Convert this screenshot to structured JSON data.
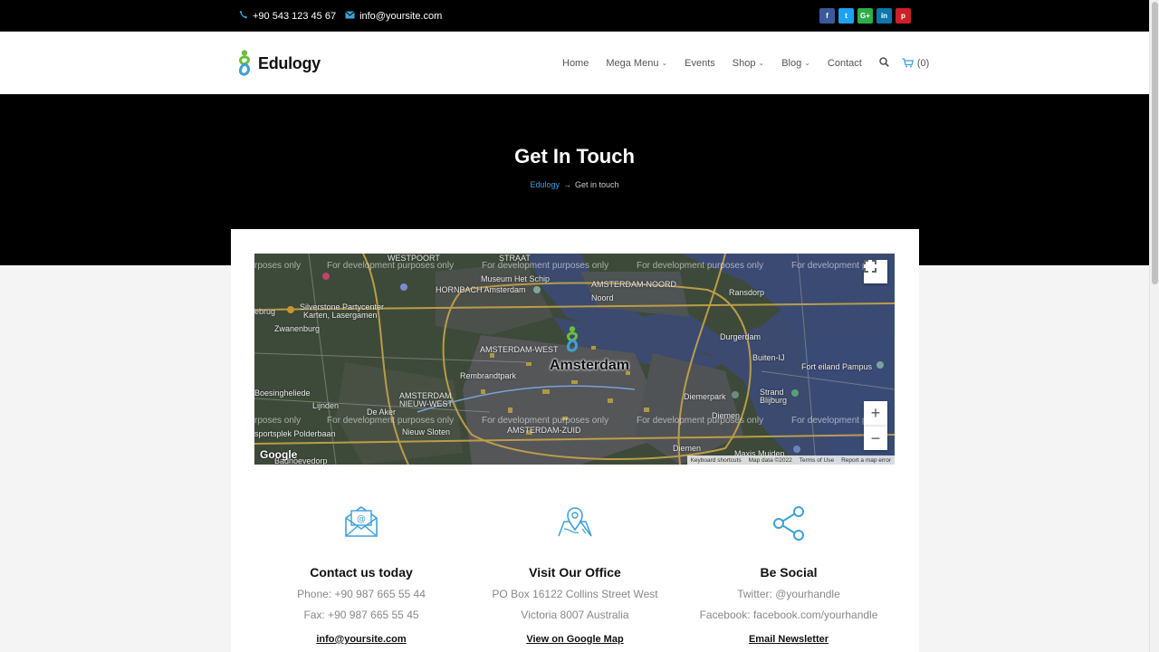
{
  "topbar": {
    "phone": "+90 543 123 45 67",
    "email": "info@yoursite.com",
    "socials": [
      {
        "name": "facebook",
        "glyph": "f",
        "color": "#3b5998"
      },
      {
        "name": "twitter",
        "glyph": "t",
        "color": "#1da1f2"
      },
      {
        "name": "google-plus",
        "glyph": "G+",
        "color": "#2eae4a"
      },
      {
        "name": "linkedin",
        "glyph": "in",
        "color": "#0e76a8"
      },
      {
        "name": "pinterest",
        "glyph": "p",
        "color": "#cb2027"
      }
    ]
  },
  "header": {
    "brand": "Edulogy",
    "nav": {
      "home": "Home",
      "mega_menu": "Mega Menu",
      "events": "Events",
      "shop": "Shop",
      "blog": "Blog",
      "contact": "Contact",
      "cart_count": "(0)"
    }
  },
  "hero": {
    "title": "Get In Touch",
    "breadcrumb_home": "Edulogy",
    "breadcrumb_current": "Get in touch"
  },
  "map": {
    "watermark": "For development purposes only",
    "watermark_cut": "rposes only",
    "watermark_tail": "For development p",
    "city": "Amsterdam",
    "places": {
      "westpoort": "WESTPOORT",
      "straat": "STRAAT",
      "museum": "Museum Het Schip",
      "noord_district": "AMSTERDAM-NOORD",
      "ransdorp": "Ransdorp",
      "noord": "Noord",
      "zwanenburg": "Zwanenburg",
      "silverstone": "Silverstone Partycenter",
      "silverstone_2": "Karten, Lasergamen",
      "hornbach": "HORNBACH Amsterdam",
      "west": "AMSTERDAM-WEST",
      "durgerdam": "Durgerdam",
      "rembrandtpark": "Rembrandtpark",
      "fortleiland": "Fort eiland Pampus",
      "boesingheliede": "Boesingheliede",
      "nieuw_west": "AMSTERDAM",
      "nieuw_west_2": "NIEUW-WEST",
      "diemerpark": "Diemerpark",
      "strand": "Strand",
      "blijburg": "Blijburg",
      "lijnden": "Lijnden",
      "de_aker": "De Aker",
      "zuid": "AMSTERDAM-ZUID",
      "diemen": "Diemen",
      "polderbaan": "sportsplek Polderbaan",
      "nieuw_sloten": "Nieuw Sloten",
      "badhoevedorp": "Badhoevedorp",
      "maxis": "Maxis Muiden",
      "buiten": "Buiten-IJ",
      "ebrug": "ebrug"
    },
    "google_label": "Google",
    "attribution": [
      "Keyboard shortcuts",
      "Map data ©2022",
      "Terms of Use",
      "Report a map error"
    ],
    "zoom_in": "+",
    "zoom_out": "−"
  },
  "info": {
    "contact": {
      "title": "Contact us today",
      "line1": "Phone: +90 987 665 55 44",
      "line2": "Fax: +90 987 665 55 45",
      "link": "info@yoursite.com"
    },
    "office": {
      "title": "Visit Our Office",
      "line1": "PO Box 16122 Collins Street West",
      "line2": "Victoria 8007 Australia",
      "link": "View on Google Map"
    },
    "social": {
      "title": "Be Social",
      "line1": "Twitter: @yourhandle",
      "line2": "Facebook: facebook.com/yourhandle",
      "link": "Email Newsletter"
    }
  },
  "colors": {
    "accent": "#3ea0d8",
    "logo_green": "#6bbf3b",
    "dark": "#000000"
  }
}
